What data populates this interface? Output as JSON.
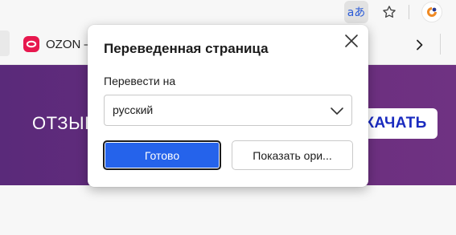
{
  "browser": {
    "toolbar": {
      "translate_icon_label": "aあ"
    },
    "bookmarks": {
      "items": [
        {
          "label": "OZON –"
        }
      ]
    }
  },
  "page": {
    "banner_text": "ОТЗЫВ",
    "banner_button": "КАЧАТЬ"
  },
  "translate_popup": {
    "title": "Переведенная страница",
    "translate_to_label": "Перевести на",
    "language_value": "русский",
    "done_button": "Готово",
    "show_original_button": "Показать ори..."
  }
}
